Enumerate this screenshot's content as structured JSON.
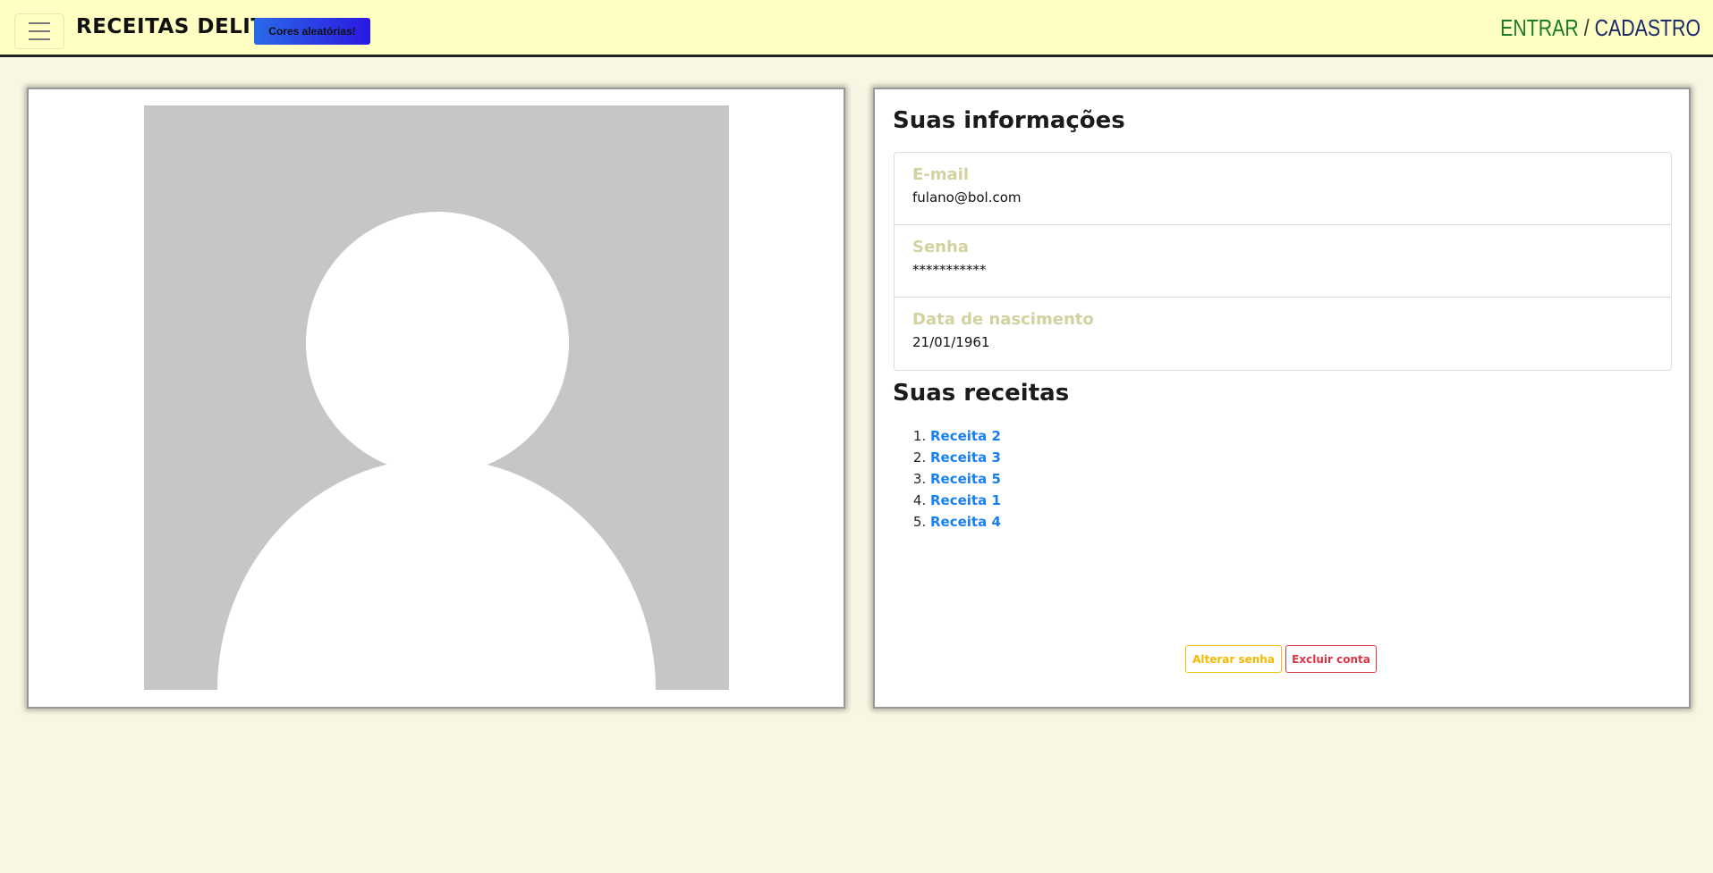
{
  "nav": {
    "brand": "RECEITAS DELIT",
    "random_colors": "Cores aleatórias!",
    "login": "ENTRAR",
    "separator": " / ",
    "register": "CADASTRO"
  },
  "info": {
    "title": "Suas informações",
    "fields": [
      {
        "label": "E-mail",
        "value": "fulano@bol.com"
      },
      {
        "label": "Senha",
        "value": "***********"
      },
      {
        "label": "Data de nascimento",
        "value": "21/01/1961"
      }
    ]
  },
  "recipes": {
    "title": "Suas receitas",
    "items": [
      "Receita 2",
      "Receita 3",
      "Receita 5",
      "Receita 1",
      "Receita 4"
    ]
  },
  "actions": {
    "change_password": "Alterar senha",
    "delete_account": "Excluir conta"
  },
  "colors": {
    "navbar": "#ffffc4",
    "background": "#f8f7e3",
    "warning": "#f5c000",
    "danger": "#dc3545",
    "link": "#1a7ef0"
  }
}
